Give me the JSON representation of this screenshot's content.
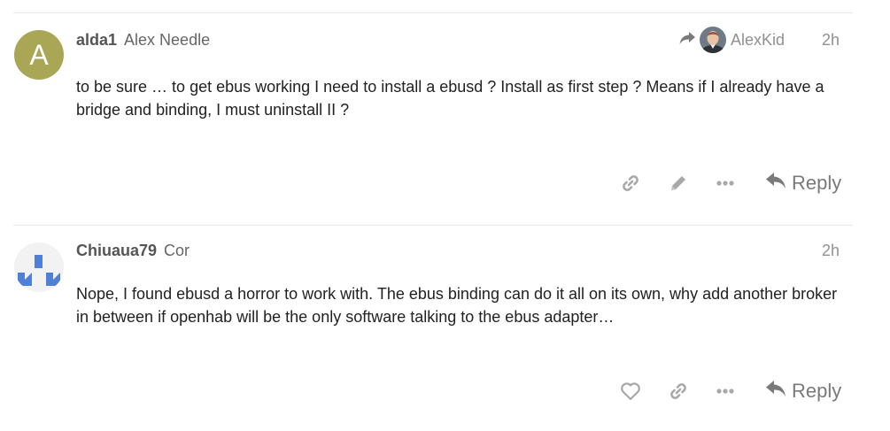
{
  "colors": {
    "avatar_a_bg": "#a9a655",
    "icon_gray": "#a8a8a8",
    "reply_gray": "#7a7a7a",
    "generated_avatar_blue": "#4f7fd6"
  },
  "posts": [
    {
      "avatar_letter": "A",
      "username": "alda1",
      "full_name": "Alex Needle",
      "reply_to": {
        "icon": "share-arrow-icon",
        "username": "AlexKid"
      },
      "time": "2h",
      "body": "to be sure … to get ebus working I need to install a ebusd ? Install as first step ? Means if I already have a bridge and binding, I must uninstall II ?",
      "actions": [
        "link-icon",
        "pencil-icon",
        "ellipsis-icon"
      ],
      "reply_label": "Reply"
    },
    {
      "avatar_letter": "",
      "username": "Chiuaua79",
      "full_name": "Cor",
      "time": "2h",
      "body": "Nope, I found ebusd a horror to work with. The ebus binding can do it all on its own, why add another broker in between if openhab will be the only software talking to the ebus adapter…",
      "actions": [
        "heart-icon",
        "link-icon",
        "ellipsis-icon"
      ],
      "reply_label": "Reply"
    }
  ]
}
